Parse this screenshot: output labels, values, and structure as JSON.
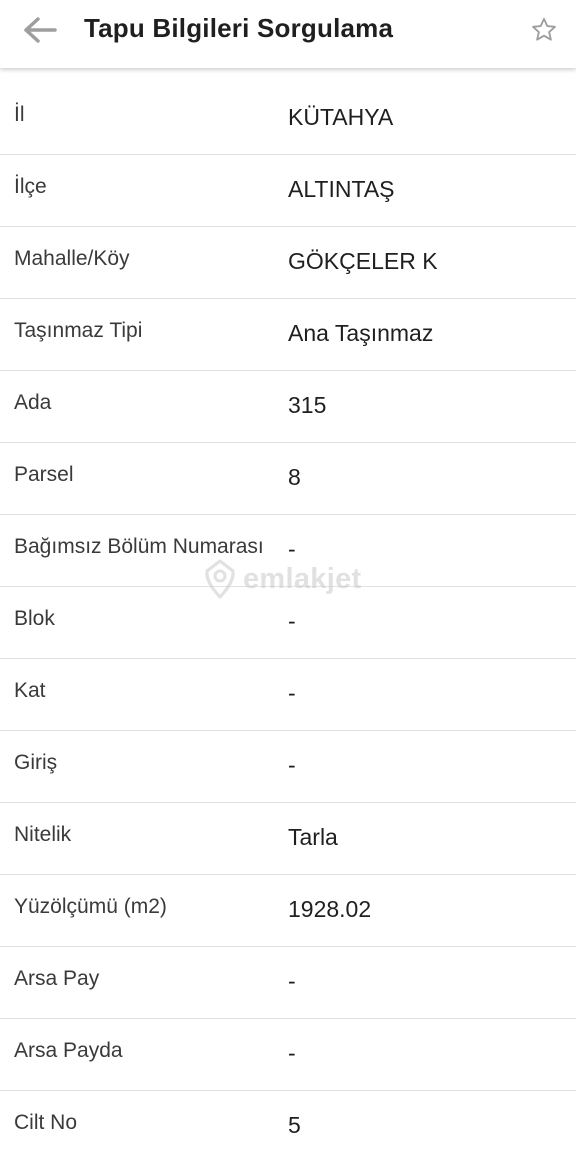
{
  "header": {
    "title": "Tapu Bilgileri Sorgulama",
    "back_icon": "arrow-left-icon",
    "favorite_icon": "star-outline-icon"
  },
  "rows": [
    {
      "label": "İl",
      "value": "KÜTAHYA"
    },
    {
      "label": "İlçe",
      "value": "ALTINTAŞ"
    },
    {
      "label": "Mahalle/Köy",
      "value": "GÖKÇELER K"
    },
    {
      "label": "Taşınmaz Tipi",
      "value": "Ana Taşınmaz"
    },
    {
      "label": "Ada",
      "value": "315"
    },
    {
      "label": "Parsel",
      "value": "8"
    },
    {
      "label": "Bağımsız Bölüm Numarası",
      "value": "-"
    },
    {
      "label": "Blok",
      "value": "-"
    },
    {
      "label": "Kat",
      "value": "-"
    },
    {
      "label": "Giriş",
      "value": "-"
    },
    {
      "label": "Nitelik",
      "value": "Tarla"
    },
    {
      "label": "Yüzölçümü (m2)",
      "value": "1928.02"
    },
    {
      "label": "Arsa Pay",
      "value": "-"
    },
    {
      "label": "Arsa Payda",
      "value": "-"
    },
    {
      "label": "Cilt No",
      "value": "5"
    }
  ],
  "watermark": {
    "text": "emlakjet",
    "icon": "home-pin-logo-icon"
  },
  "colors": {
    "title": "#1f1f1f",
    "label": "#3a3a3a",
    "divider": "#e2e2e2",
    "icon": "#9e9e9e",
    "watermark": "#c9c9c9"
  }
}
